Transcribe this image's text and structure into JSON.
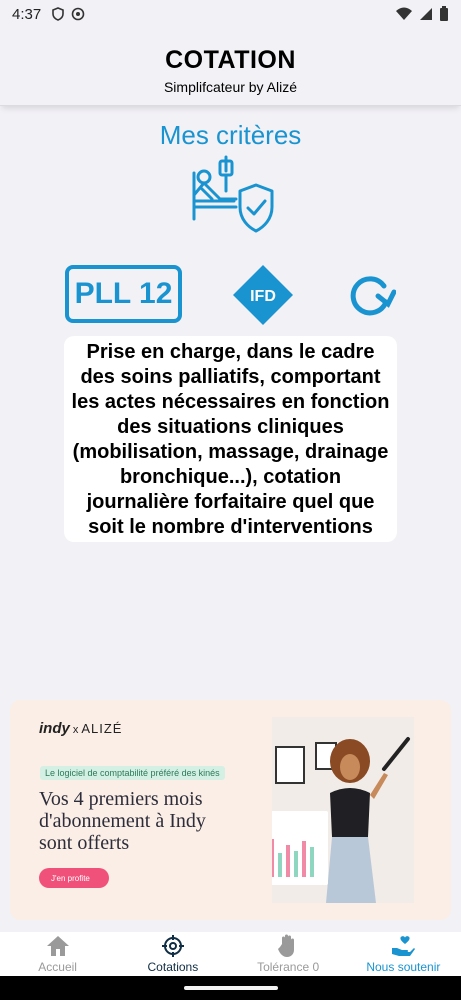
{
  "status_bar": {
    "time": "4:37"
  },
  "header": {
    "title": "COTATION",
    "subtitle": "Simplifcateur by Alizé"
  },
  "criteria": {
    "title": "Mes critères"
  },
  "act": {
    "code": "PLL 12",
    "ifd_label": "IFD",
    "description": "Prise en charge, dans le cadre des soins palliatifs, comportant les actes nécessaires en fonction des situations cliniques (mobilisation, massage, drainage bronchique...), cotation journalière forfaitaire quel que soit le nombre d'interventions"
  },
  "ad": {
    "logo_brand": "indy",
    "logo_x": "x",
    "logo_partner": "ALIZÉ",
    "tag": "Le logiciel de comptabilité préféré des kinés",
    "headline": "Vos 4 premiers mois d'abonnement à Indy sont offerts",
    "cta": "J'en profite"
  },
  "bottom_nav": {
    "items": [
      {
        "label": "Accueil",
        "icon": "home-icon"
      },
      {
        "label": "Cotations",
        "icon": "crosshair-icon"
      },
      {
        "label": "Tolérance 0",
        "icon": "hand-icon"
      },
      {
        "label": "Nous soutenir",
        "icon": "heart-hand-icon"
      }
    ]
  },
  "colors": {
    "accent": "#1a94d0",
    "nav_active": "#0f2d44",
    "nav_inactive": "#9a9a9a",
    "cta": "#f0517a"
  }
}
